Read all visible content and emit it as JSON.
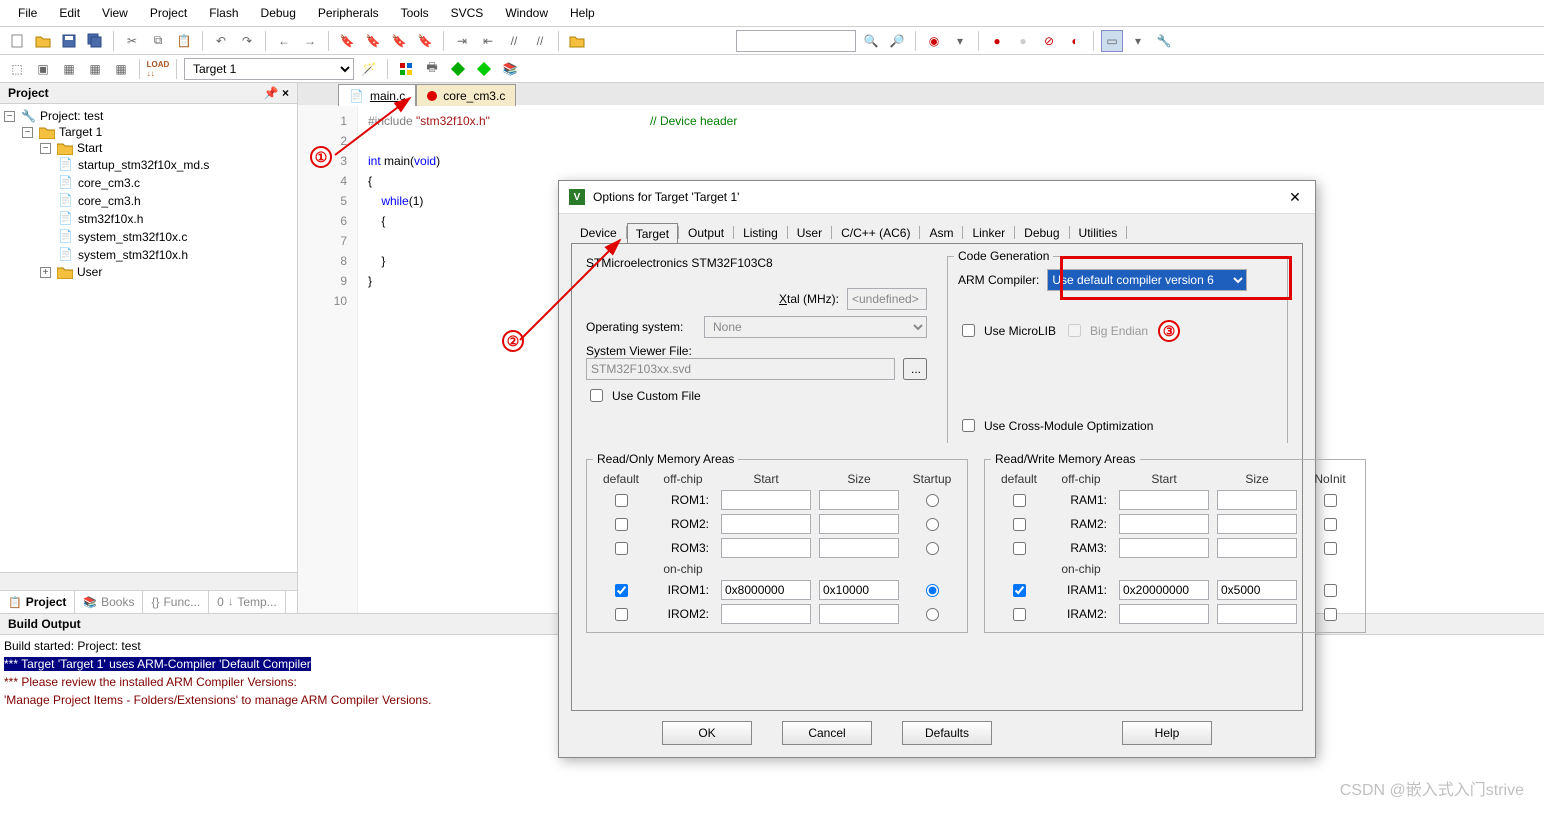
{
  "menu": [
    "File",
    "Edit",
    "View",
    "Project",
    "Flash",
    "Debug",
    "Peripherals",
    "Tools",
    "SVCS",
    "Window",
    "Help"
  ],
  "target_select": "Target 1",
  "project_panel_title": "Project",
  "tree": {
    "root": "Project: test",
    "target": "Target 1",
    "group1": "Start",
    "files1": [
      "startup_stm32f10x_md.s",
      "core_cm3.c",
      "core_cm3.h",
      "stm32f10x.h",
      "system_stm32f10x.c",
      "system_stm32f10x.h"
    ],
    "group2": "User"
  },
  "project_tabs": {
    "t1": "Project",
    "t2": "Books",
    "t3": "Func...",
    "t4": "Temp..."
  },
  "editor_tabs": {
    "t1": "main.c",
    "t2": "core_cm3.c"
  },
  "code_lines": [
    "1",
    "2",
    "3",
    "4",
    "5",
    "6",
    "7",
    "8",
    "9",
    "10"
  ],
  "code": {
    "inc": "#include",
    "incfile": "\"stm32f10x.h\"",
    "inccom": "// Device header",
    "kw_int": "int",
    "main": "main",
    "kw_void": "void",
    "kw_while": "while",
    "one": "1"
  },
  "build_title": "Build Output",
  "build": {
    "l1": "Build started: Project: test",
    "l2": "*** Target 'Target 1' uses ARM-Compiler 'Default Compiler",
    "l3": "*** Please review the installed ARM Compiler Versions:",
    "l4": "    'Manage Project Items - Folders/Extensions' to manage ARM Compiler Versions."
  },
  "dialog": {
    "title": "Options for Target 'Target 1'",
    "tabs": [
      "Device",
      "Target",
      "Output",
      "Listing",
      "User",
      "C/C++ (AC6)",
      "Asm",
      "Linker",
      "Debug",
      "Utilities"
    ],
    "device": "STMicroelectronics STM32F103C8",
    "xtal_label": "Xtal (MHz):",
    "xtal_value": "<undefined>",
    "os_label": "Operating system:",
    "os_value": "None",
    "svf_label": "System Viewer File:",
    "svf_value": "STM32F103xx.svd",
    "custom_file": "Use Custom File",
    "codegen_label": "Code Generation",
    "armcc_label": "ARM Compiler:",
    "armcc_value": "Use default compiler version 6",
    "microlib": "Use MicroLIB",
    "bigendian": "Big Endian",
    "crossmod": "Use Cross-Module Optimization",
    "ro_label": "Read/Only Memory Areas",
    "rw_label": "Read/Write Memory Areas",
    "hdr_default": "default",
    "hdr_offchip": "off-chip",
    "hdr_onchip": "on-chip",
    "hdr_start": "Start",
    "hdr_size": "Size",
    "hdr_startup": "Startup",
    "hdr_noinit": "NoInit",
    "rom1": "ROM1:",
    "rom2": "ROM2:",
    "rom3": "ROM3:",
    "irom1": "IROM1:",
    "irom2": "IROM2:",
    "ram1": "RAM1:",
    "ram2": "RAM2:",
    "ram3": "RAM3:",
    "iram1": "IRAM1:",
    "iram2": "IRAM2:",
    "irom1_start": "0x8000000",
    "irom1_size": "0x10000",
    "iram1_start": "0x20000000",
    "iram1_size": "0x5000",
    "btn_ok": "OK",
    "btn_cancel": "Cancel",
    "btn_defaults": "Defaults",
    "btn_help": "Help"
  },
  "callouts": {
    "c1": "①",
    "c2": "②",
    "c3": "③"
  },
  "watermark": "CSDN @嵌入式入门strive",
  "prefix": {
    "func": "{}",
    "tmpl": "0"
  },
  "panel_ctrl": {
    "pin": "📌",
    "close": "×"
  }
}
